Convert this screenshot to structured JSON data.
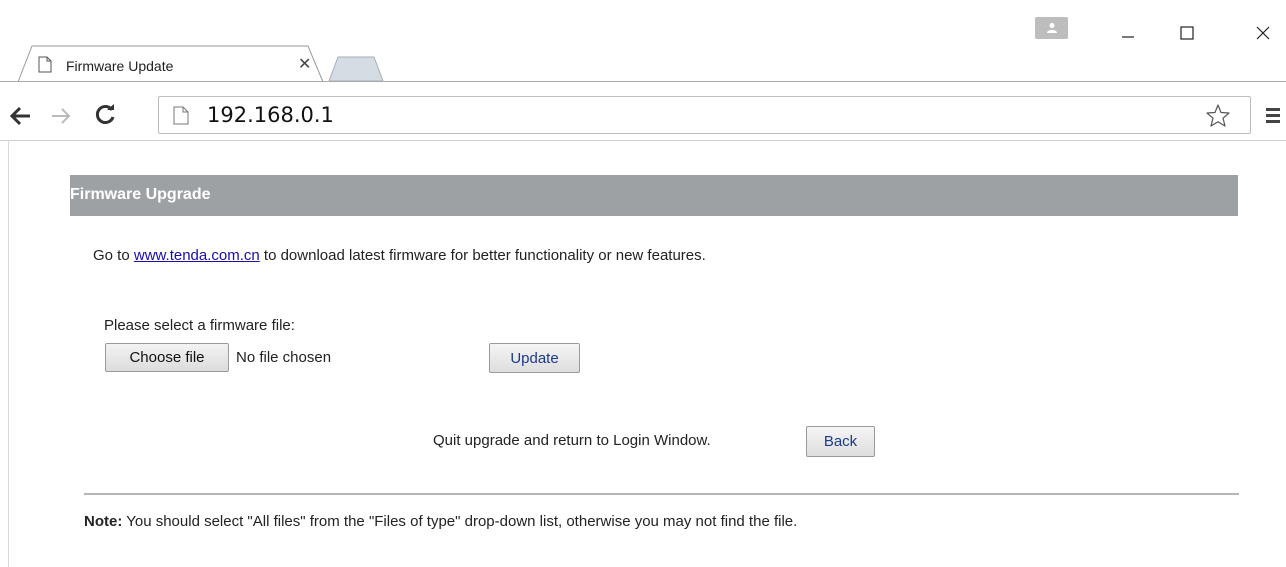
{
  "browser": {
    "tab": {
      "title": "Firmware Update"
    },
    "url": "192.168.0.1",
    "icons": [
      "user-icon",
      "minimize-icon",
      "maximize-icon",
      "close-icon",
      "page-icon",
      "back-arrow-icon",
      "forward-arrow-icon",
      "reload-icon",
      "star-icon",
      "menu-icon"
    ]
  },
  "page": {
    "header": "Firmware Upgrade",
    "intro_prefix": "Go to ",
    "intro_link": "www.tenda.com.cn",
    "intro_suffix": " to download latest firmware for better functionality or new  features.",
    "select_label": "Please select a firmware file:",
    "choose_file_label": "Choose file",
    "no_file_text": "No file chosen",
    "update_label": "Update",
    "quit_text": "Quit upgrade and return to Login Window.",
    "back_label": "Back",
    "note_label": "Note:",
    "note_text": " You should select \"All files\" from the \"Files of type\" drop-down list, otherwise you may not find the file."
  },
  "colors": {
    "header_bg": "#9ea1a3",
    "link": "#1a0dab",
    "button_text": "#1b3a8a"
  }
}
